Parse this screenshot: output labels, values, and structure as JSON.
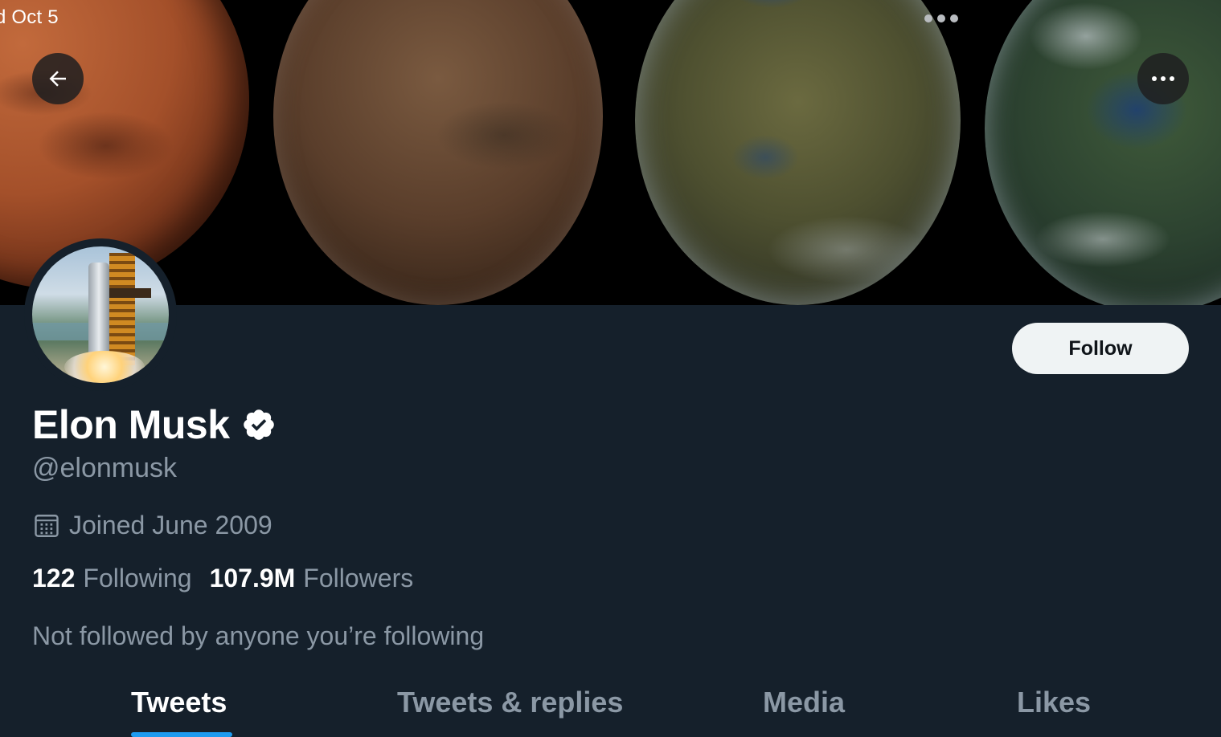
{
  "status_bar": {
    "date": "d Oct 5"
  },
  "header": {
    "back_icon": "arrow-left-icon",
    "more_icon": "more-horizontal-icon"
  },
  "profile": {
    "name": "Elon Musk",
    "verified_icon": "verified-badge-icon",
    "handle": "@elonmusk",
    "joined": "Joined June 2009",
    "following_count": "122",
    "following_label": "Following",
    "followers_count": "107.9M",
    "followers_label": "Followers",
    "social_context": "Not followed by anyone you’re following",
    "follow_button": "Follow"
  },
  "tabs": [
    {
      "label": "Tweets",
      "active": true
    },
    {
      "label": "Tweets & replies",
      "active": false
    },
    {
      "label": "Media",
      "active": false
    },
    {
      "label": "Likes",
      "active": false
    }
  ],
  "colors": {
    "background": "#15202b",
    "accent": "#1d9bf0",
    "secondary_text": "#8b98a5",
    "follow_button_bg": "#eff3f4"
  }
}
